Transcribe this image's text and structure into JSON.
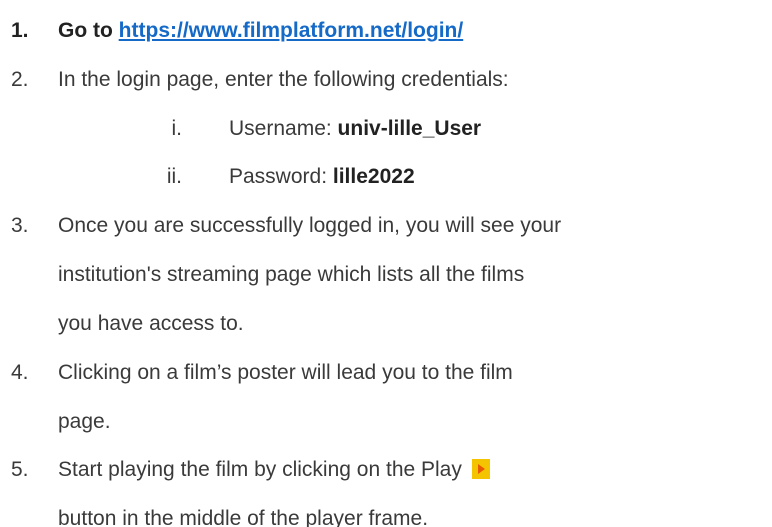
{
  "steps": [
    {
      "number": "1.",
      "text_before": "Go to",
      "link": "https://www.filmplatform.net/login/"
    },
    {
      "number": "2.",
      "text": "In the login page, enter the following credentials:",
      "substeps": [
        {
          "number": "i.",
          "label": "Username:",
          "value": "univ-lille_User"
        },
        {
          "number": "ii.",
          "label": "Password:",
          "value": "lille2022"
        }
      ]
    },
    {
      "number": "3.",
      "lines": [
        "Once you are successfully logged in, you will see your",
        "institution's streaming page which lists all the  films",
        "you have access to."
      ]
    },
    {
      "number": "4.",
      "lines": [
        "Clicking on a film’s poster will lead you to the film",
        "page."
      ]
    },
    {
      "number": "5.",
      "line1": "Start playing the film by clicking on the Play",
      "line2": "button in the middle of the player frame.",
      "icon": "play-icon",
      "icon_color": "#f4c400"
    }
  ]
}
